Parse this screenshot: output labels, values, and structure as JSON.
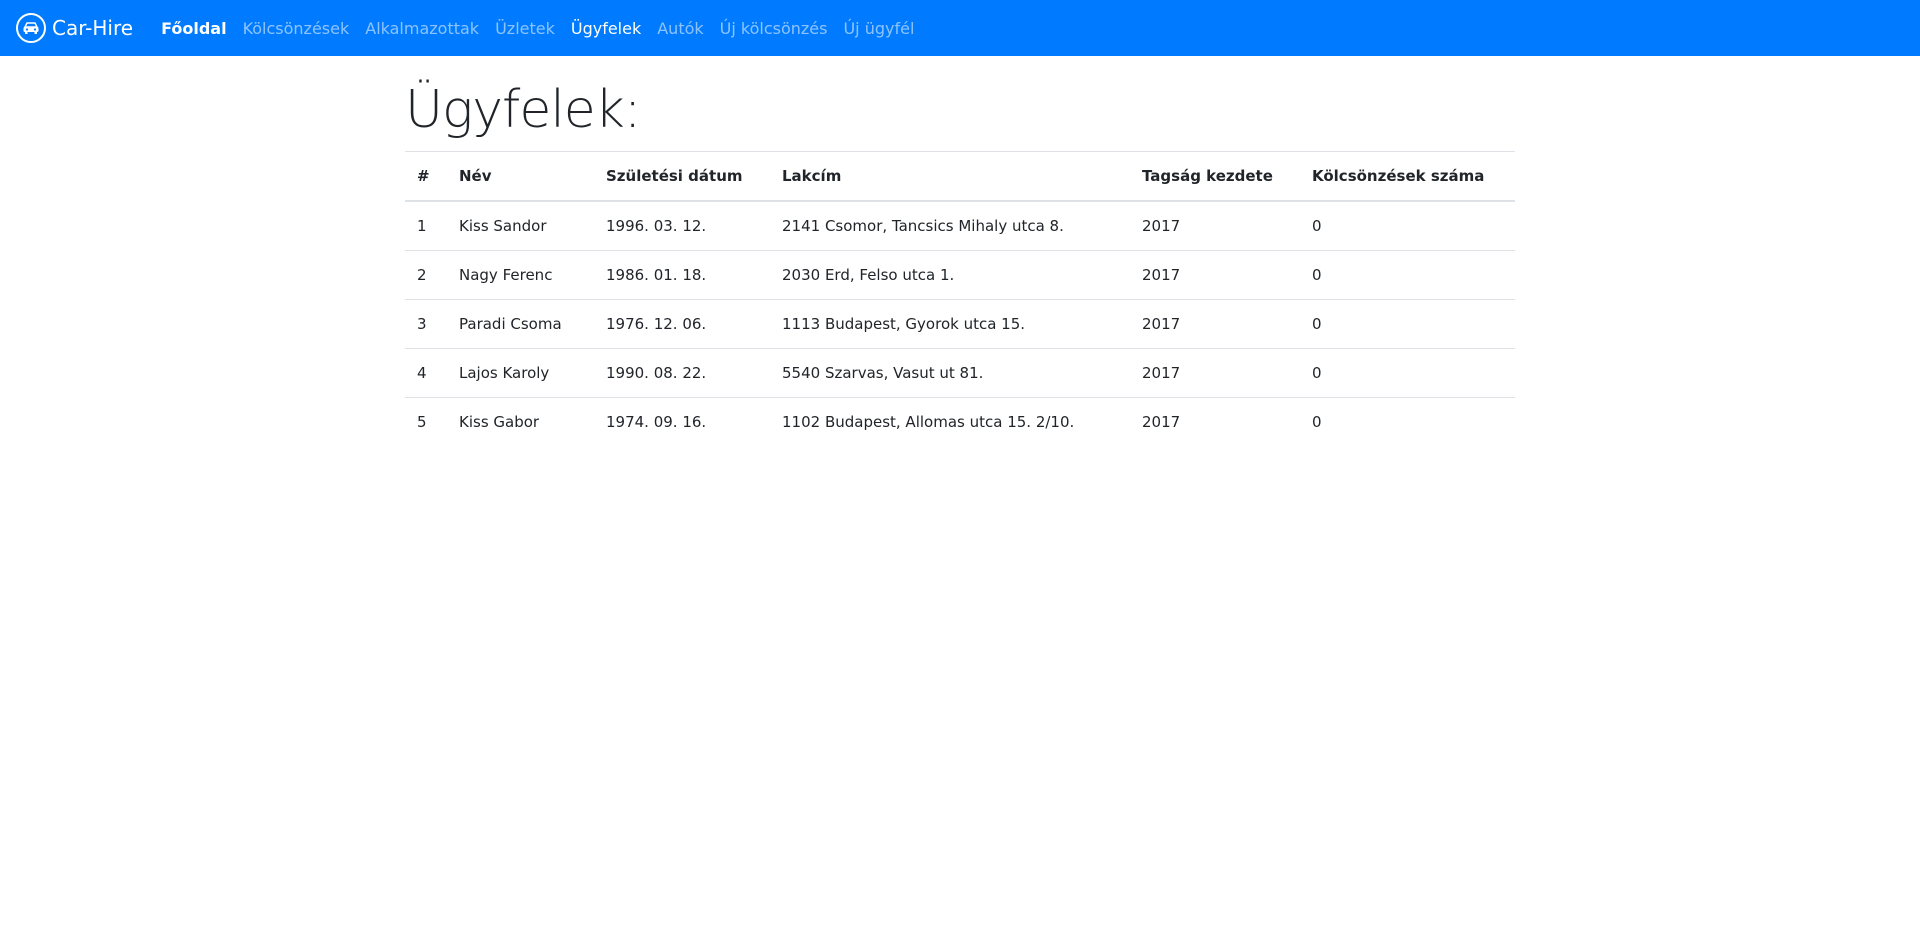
{
  "navbar": {
    "brand": "Car-Hire",
    "brand_icon": "car-icon",
    "bg_color": "#007bff",
    "links": [
      {
        "label": "Főoldal",
        "state": "bold"
      },
      {
        "label": "Kölcsönzések",
        "state": "normal"
      },
      {
        "label": "Alkalmazottak",
        "state": "normal"
      },
      {
        "label": "Üzletek",
        "state": "normal"
      },
      {
        "label": "Ügyfelek",
        "state": "active"
      },
      {
        "label": "Autók",
        "state": "normal"
      },
      {
        "label": "Új kölcsönzés",
        "state": "normal"
      },
      {
        "label": "Új ügyfél",
        "state": "normal"
      }
    ]
  },
  "page": {
    "title": "Ügyfelek:"
  },
  "table": {
    "headers": [
      "#",
      "Név",
      "Születési dátum",
      "Lakcím",
      "Tagság kezdete",
      "Kölcsönzések száma"
    ],
    "rows": [
      [
        "1",
        "Kiss Sandor",
        "1996. 03. 12.",
        "2141 Csomor, Tancsics Mihaly utca 8.",
        "2017",
        "0"
      ],
      [
        "2",
        "Nagy Ferenc",
        "1986. 01. 18.",
        "2030 Erd, Felso utca 1.",
        "2017",
        "0"
      ],
      [
        "3",
        "Paradi Csoma",
        "1976. 12. 06.",
        "1113 Budapest, Gyorok utca 15.",
        "2017",
        "0"
      ],
      [
        "4",
        "Lajos Karoly",
        "1990. 08. 22.",
        "5540 Szarvas, Vasut ut 81.",
        "2017",
        "0"
      ],
      [
        "5",
        "Kiss Gabor",
        "1974. 09. 16.",
        "1102 Budapest, Allomas utca 15. 2/10.",
        "2017",
        "0"
      ]
    ]
  }
}
